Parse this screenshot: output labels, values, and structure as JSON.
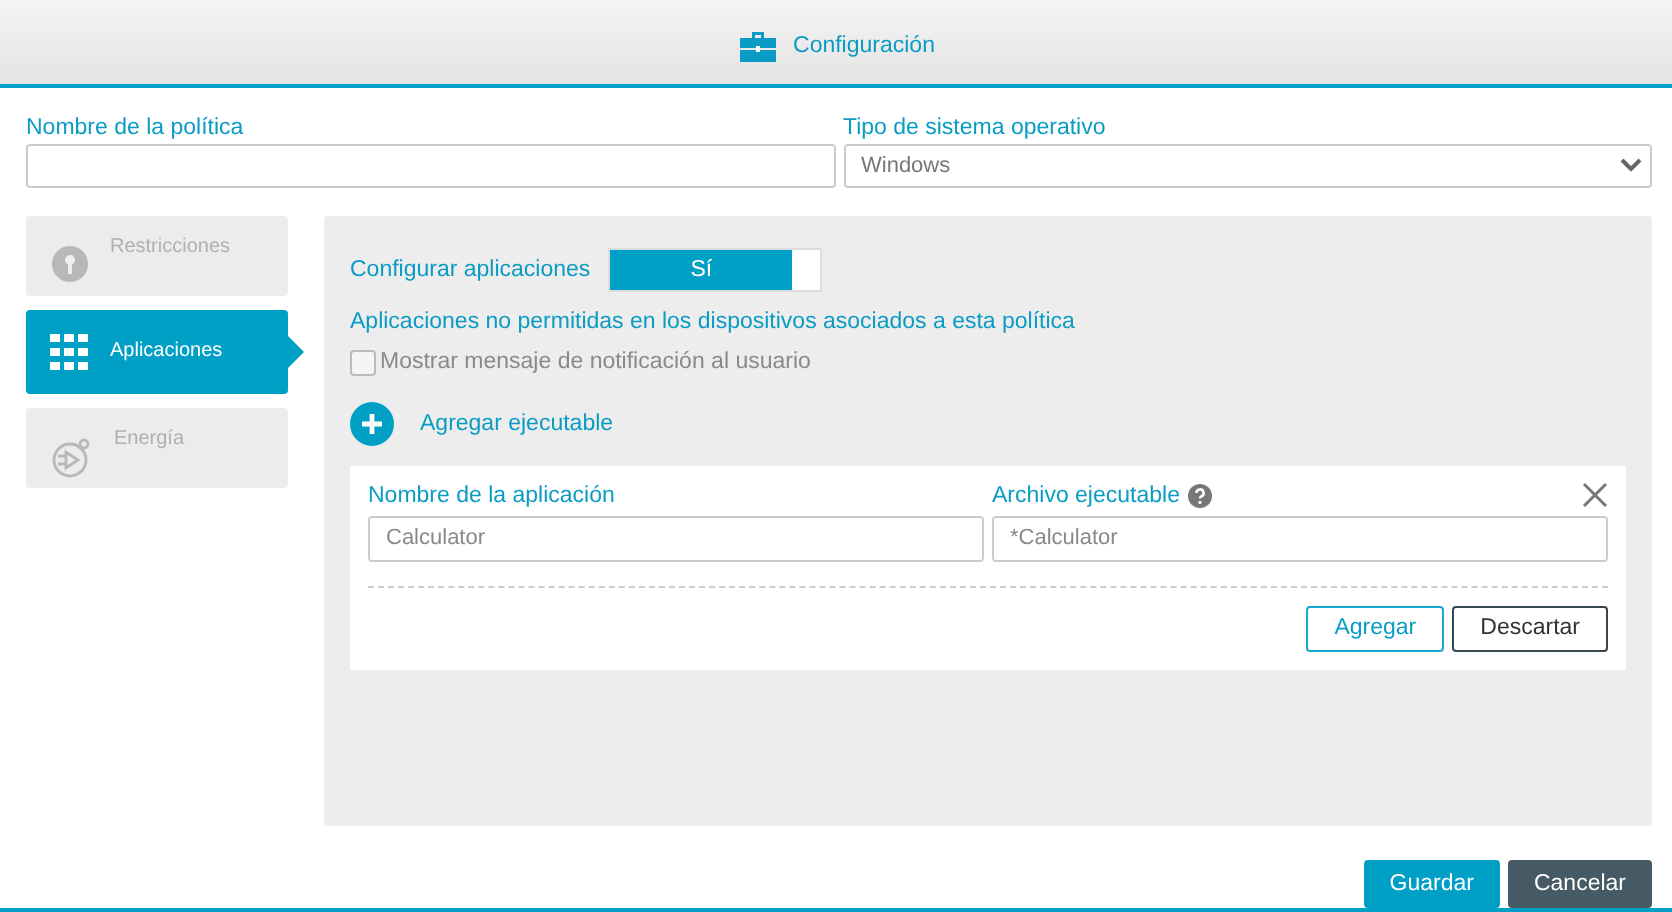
{
  "window": {
    "title": "Configuración"
  },
  "policy_name": {
    "label": "Nombre de la política"
  },
  "os_type": {
    "label": "Tipo de sistema operativo",
    "value": "Windows"
  },
  "sidebar": {
    "items": [
      {
        "label": "Restricciones",
        "kind": "lock",
        "selected": false
      },
      {
        "label": "Aplicaciones",
        "kind": "grid",
        "selected": true
      },
      {
        "label": "Energía",
        "kind": "power",
        "selected": false
      }
    ]
  },
  "panel": {
    "configure_label": "Configurar aplicaciones",
    "toggle": {
      "label": "Sí",
      "on": true
    },
    "heading": "Aplicaciones no permitidas en los dispositivos asociados a esta política",
    "notify": {
      "label": "Mostrar mensaje de notificación al usuario",
      "checked": false
    },
    "add_label": "Agregar ejecutable",
    "form": {
      "fields": [
        {
          "label": "Nombre de la aplicación",
          "placeholder": "Calculator",
          "help": false
        },
        {
          "label": "Archivo ejecutable",
          "placeholder": "*Calculator",
          "help": true
        }
      ],
      "buttons": [
        "Agregar",
        "Descartar"
      ]
    }
  },
  "footer_buttons": [
    "Guardar",
    "Cancelar"
  ]
}
